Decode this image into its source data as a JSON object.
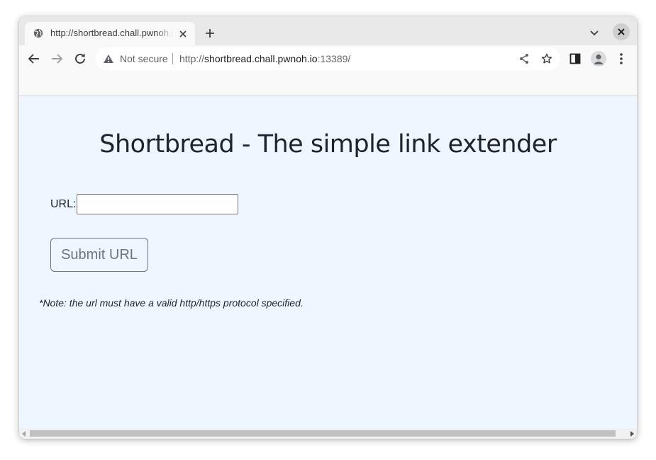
{
  "tab": {
    "title": "http://shortbread.chall.pwnoh.io:13389/",
    "favicon": "globe-icon"
  },
  "toolbar": {
    "security_label": "Not secure",
    "url_scheme": "http://",
    "url_host": "shortbread.chall.pwnoh.io",
    "url_port_path": ":13389/"
  },
  "page": {
    "heading": "Shortbread - The simple link extender",
    "url_label": "URL:",
    "url_value": "",
    "submit_label": "Submit URL",
    "note": "*Note: the url must have a valid http/https protocol specified."
  },
  "colors": {
    "page_background": "#eef6ff",
    "heading_text": "#212529",
    "button_outline": "#6c757d"
  }
}
